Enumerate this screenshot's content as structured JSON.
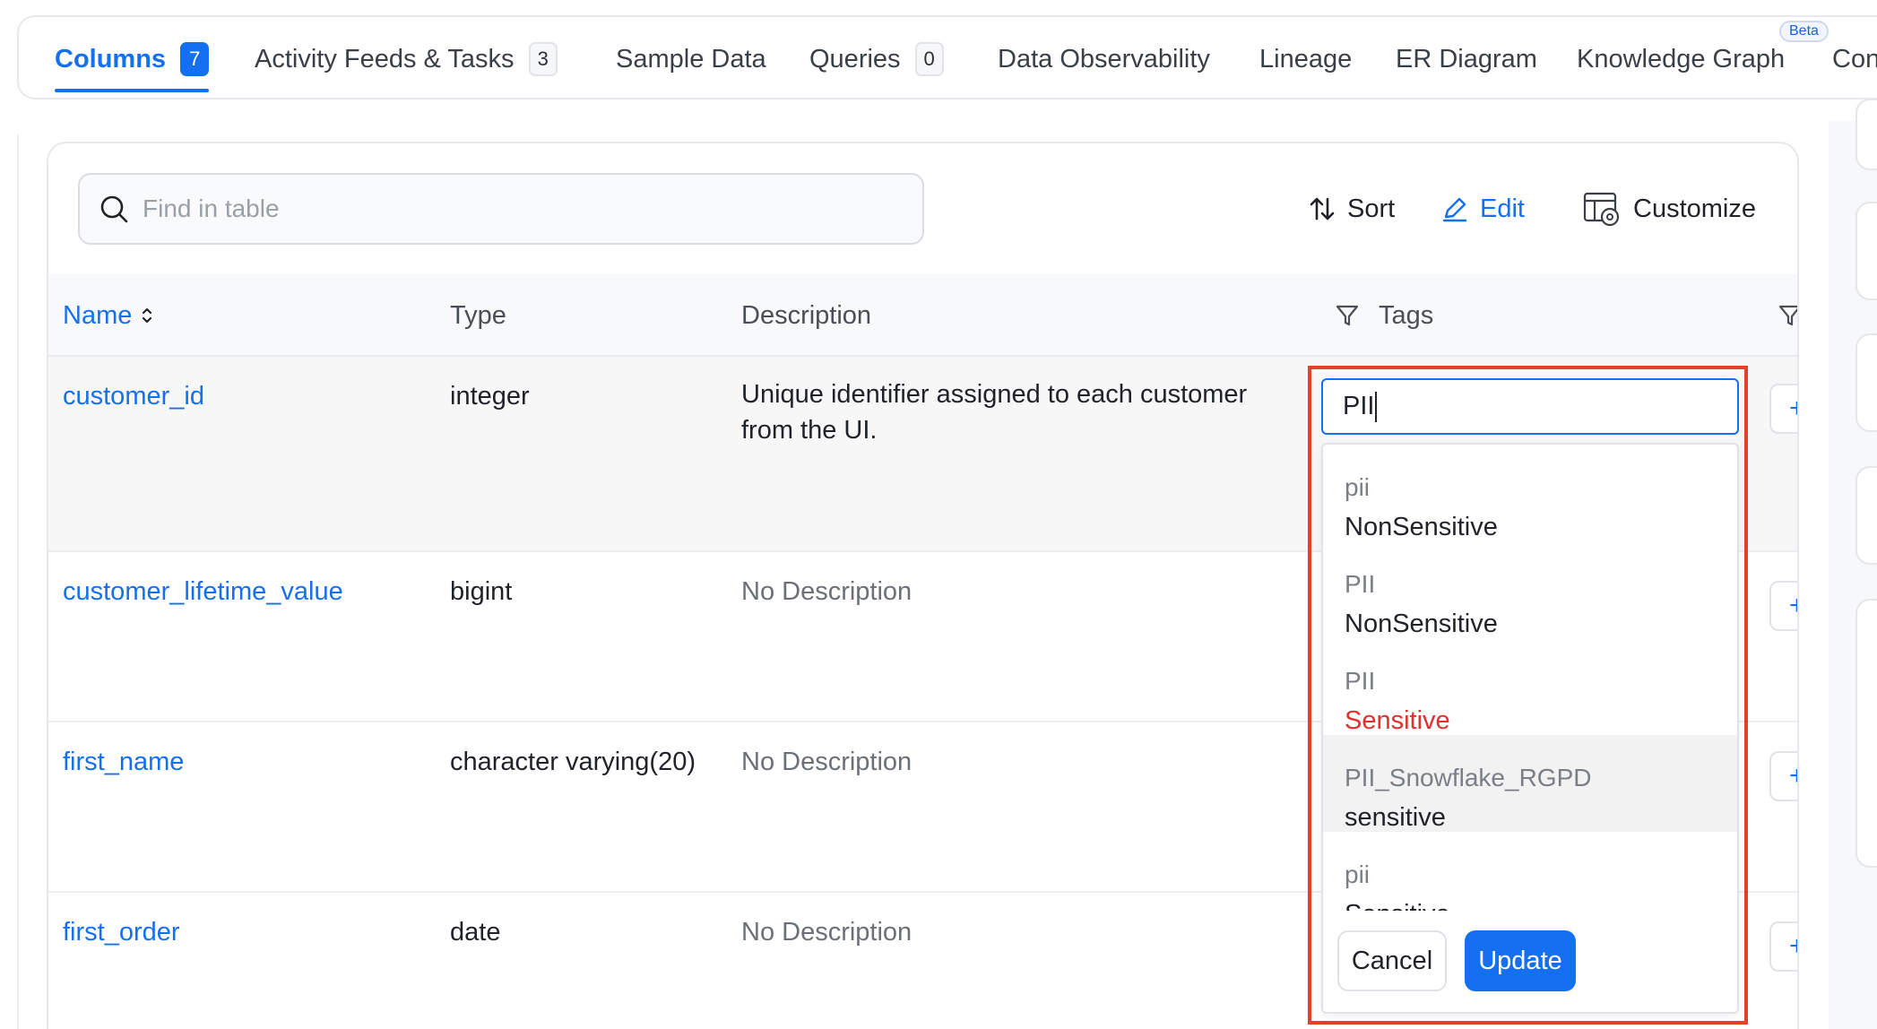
{
  "tabs": [
    {
      "label": "Columns",
      "count": "7"
    },
    {
      "label": "Activity Feeds & Tasks",
      "count": "3"
    },
    {
      "label": "Sample Data"
    },
    {
      "label": "Queries",
      "count": "0"
    },
    {
      "label": "Data Observability"
    },
    {
      "label": "Lineage"
    },
    {
      "label": "ER Diagram"
    },
    {
      "label": "Knowledge Graph",
      "badge": "Beta"
    },
    {
      "label": "Con"
    }
  ],
  "toolbar": {
    "search_placeholder": "Find in table",
    "sort_label": "Sort",
    "edit_label": "Edit",
    "customize_label": "Customize"
  },
  "table": {
    "headers": {
      "name": "Name",
      "type": "Type",
      "description": "Description",
      "tags": "Tags"
    },
    "rows": [
      {
        "name": "customer_id",
        "type": "integer",
        "description": "Unique identifier assigned to each customer from the UI."
      },
      {
        "name": "customer_lifetime_value",
        "type": "bigint",
        "description": "No Description"
      },
      {
        "name": "first_name",
        "type": "character varying(20)",
        "description": "No Description"
      },
      {
        "name": "first_order",
        "type": "date",
        "description": "No Description"
      }
    ]
  },
  "tag_editor": {
    "input_value": "PII",
    "options": [
      {
        "classification": "pii",
        "tag": "NonSensitive"
      },
      {
        "classification": "PII",
        "tag": "NonSensitive"
      },
      {
        "classification": "PII",
        "tag": "Sensitive"
      },
      {
        "classification": "PII_Snowflake_RGPD",
        "tag": "sensitive"
      },
      {
        "classification": "pii",
        "tag": "Sensitive"
      }
    ],
    "cancel_label": "Cancel",
    "update_label": "Update"
  },
  "colors": {
    "accent": "#1570ef",
    "highlight_border": "#e3402e",
    "sensitive_text": "#e3302e"
  },
  "icons": [
    "search-icon",
    "sort-icon",
    "edit-pencil-icon",
    "customize-table-icon",
    "sort-toggle-icon",
    "filter-icon",
    "add-icon"
  ]
}
